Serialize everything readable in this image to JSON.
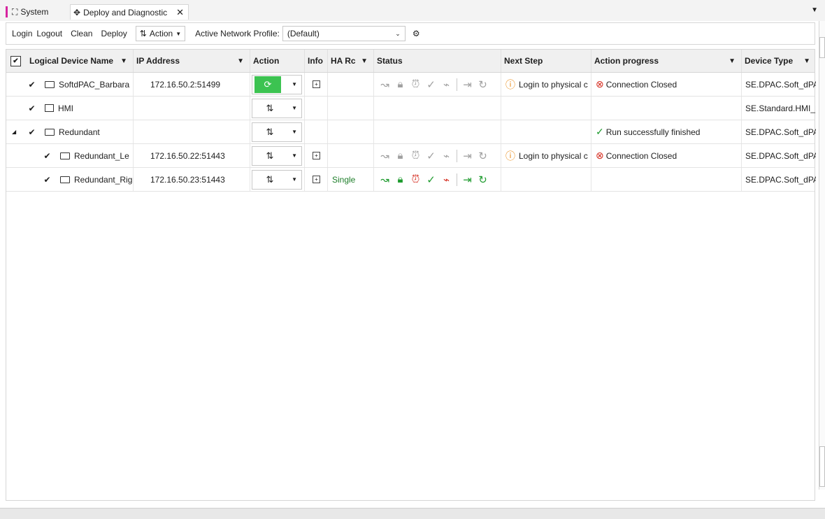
{
  "tabs": [
    {
      "label": "System"
    },
    {
      "label": "Deploy and Diagnostic"
    }
  ],
  "toolbar": {
    "login": "Login",
    "logout": "Logout",
    "clean": "Clean",
    "deploy": "Deploy",
    "action": "Action",
    "profile_label": "Active Network Profile:",
    "profile_value": "(Default)"
  },
  "columns": {
    "name": "Logical Device Name",
    "ip": "IP Address",
    "action": "Action",
    "info": "Info",
    "ha": "HA Rc",
    "status": "Status",
    "next": "Next Step",
    "progress": "Action progress",
    "type": "Device Type"
  },
  "rows": [
    {
      "name": "SoftdPAC_Barbara",
      "ip": "172.16.50.2:51499",
      "ha": "",
      "next": "Login to physical c",
      "progress": "Connection Closed",
      "type": "SE.DPAC.Soft_dPAC"
    },
    {
      "name": "HMI",
      "ip": "",
      "ha": "",
      "next": "",
      "progress": "",
      "type": "SE.Standard.HMI_N"
    },
    {
      "name": "Redundant",
      "ip": "",
      "ha": "",
      "next": "",
      "progress": "Run successfully finished",
      "type": "SE.DPAC.Soft_dPAC"
    },
    {
      "name": "Redundant_Le",
      "ip": "172.16.50.22:51443",
      "ha": "",
      "next": "Login to physical c",
      "progress": "Connection Closed",
      "type": "SE.DPAC.Soft_dPAC"
    },
    {
      "name": "Redundant_Rig",
      "ip": "172.16.50.23:51443",
      "ha": "Single",
      "next": "",
      "progress": "",
      "type": "SE.DPAC.Soft_dPAC"
    }
  ],
  "colors": {
    "status_ok": "#1e9b2e",
    "status_err": "#d52b1e",
    "status_warn": "#e8860c",
    "status_gray": "#a0a0a0",
    "accent": "#d6249f"
  }
}
